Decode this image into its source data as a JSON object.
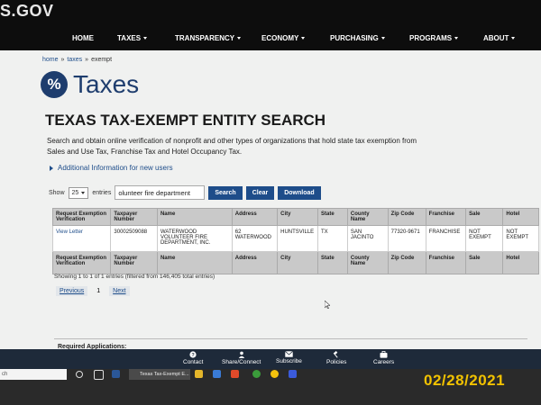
{
  "site": {
    "logo": "S.GOV"
  },
  "nav": [
    {
      "label": "HOME"
    },
    {
      "label": "TAXES"
    },
    {
      "label": "TRANSPARENCY"
    },
    {
      "label": "ECONOMY"
    },
    {
      "label": "PURCHASING"
    },
    {
      "label": "PROGRAMS"
    },
    {
      "label": "ABOUT"
    }
  ],
  "breadcrumb": [
    "home",
    "taxes",
    "exempt"
  ],
  "brand": {
    "icon_text": "%",
    "title": "Taxes"
  },
  "page_title": "TEXAS TAX-EXEMPT ENTITY SEARCH",
  "description": "Search and obtain online verification of nonprofit and other types of organizations that hold state tax exemption from Sales and Use Tax, Franchise Tax and Hotel Occupancy Tax.",
  "additional_info": "Additional Information for new users",
  "controls": {
    "show_label": "Show",
    "entries_value": "25",
    "entries_label": "entries",
    "search_value": "olunteer fire department",
    "search_button": "Search",
    "clear_button": "Clear",
    "download_button": "Download"
  },
  "table": {
    "headers": [
      "Request Exemption Verification",
      "Taxpayer Number",
      "Name",
      "Address",
      "City",
      "State",
      "County Name",
      "Zip Code",
      "Franchise",
      "Sale",
      "Hotel"
    ],
    "rows": [
      [
        "View Letter",
        "30002509088",
        "WATERWOOD VOLUNTEER FIRE DEPARTMENT, INC.",
        "62 WATERWOOD",
        "HUNTSVILLE",
        "TX",
        "SAN JACINTO",
        "77320-9671",
        "FRANCHISE",
        "NOT EXEMPT",
        "NOT EXEMPT"
      ]
    ],
    "footer": [
      "Request Exemption Verification",
      "Taxpayer Number",
      "Name",
      "Address",
      "City",
      "State",
      "County Name",
      "Zip Code",
      "Franchise",
      "Sale",
      "Hotel"
    ]
  },
  "showing_text": "Showing 1 to 1 of 1 entries (filtered from 146,405 total entries)",
  "pager": {
    "previous": "Previous",
    "current": "1",
    "next": "Next"
  },
  "required_applications": "Required Applications:",
  "footer_links": [
    "Contact",
    "Share/Connect",
    "Subscribe",
    "Policies",
    "Careers"
  ],
  "taskbar": {
    "search_text": "ch",
    "task_label": "Texas Tax-Exempt E..."
  },
  "date_stamp": "02/28/2021",
  "colors": {
    "brand_blue": "#1e3d6e",
    "button_blue": "#1e4d8a",
    "stamp_yellow": "#f2c200"
  },
  "icons": [
    "percent-icon",
    "triangle-right-icon",
    "caret-down-icon",
    "question-icon",
    "person-icon",
    "envelope-icon",
    "gavel-icon",
    "briefcase-icon"
  ]
}
